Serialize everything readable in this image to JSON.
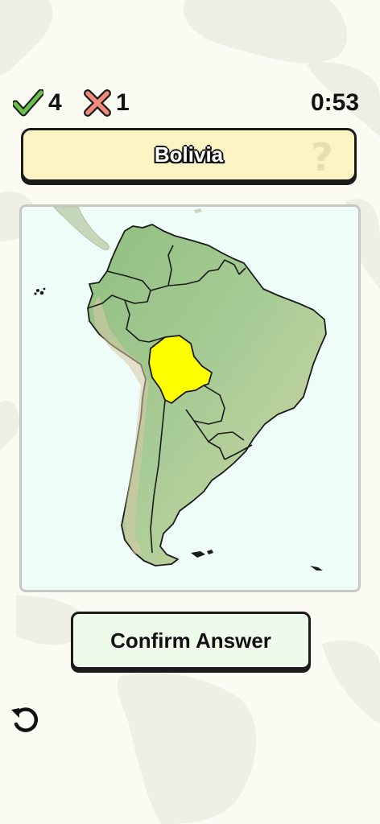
{
  "score": {
    "correct_count": "4",
    "wrong_count": "1",
    "correct_icon": "check-icon",
    "wrong_icon": "cross-icon"
  },
  "timer": "0:53",
  "question": {
    "country": "Bolivia",
    "hint_icon": "question-mark-icon"
  },
  "map": {
    "highlight_color": "#ffff00",
    "land_color": "#a9cc96",
    "water_color": "#eefdf7"
  },
  "actions": {
    "confirm_label": "Confirm Answer",
    "undo_icon": "undo-icon"
  },
  "colors": {
    "background": "#fbfbf3",
    "banner": "#fdf4c4",
    "button": "#effbea",
    "check": "#69c04a",
    "cross": "#f08b7b"
  }
}
